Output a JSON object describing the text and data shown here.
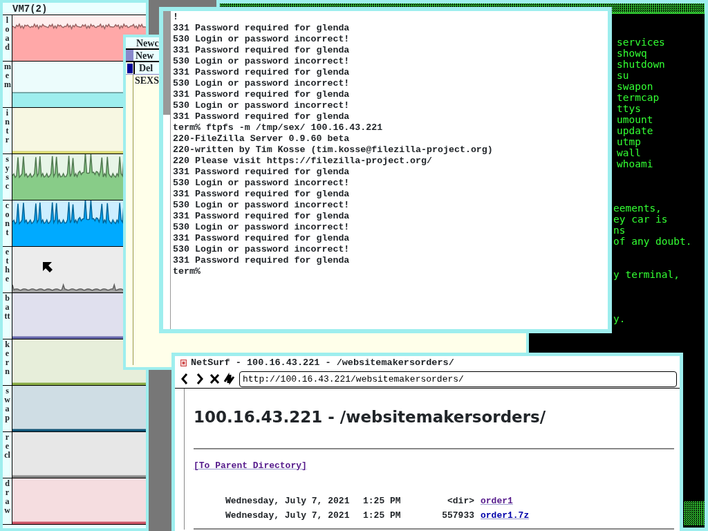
{
  "stats_window": {
    "title": "VM7(2)",
    "graphs": [
      {
        "label": "load",
        "kind": "wave",
        "color": "#ffa8a8"
      },
      {
        "label": "mem",
        "kind": "band",
        "color": "#9eeeee"
      },
      {
        "label": "intr",
        "kind": "flat",
        "color": "#d8d870"
      },
      {
        "label": "sysc",
        "kind": "spiky",
        "color": "#88cc88"
      },
      {
        "label": "cont",
        "kind": "spiky",
        "color": "#00aaff"
      },
      {
        "label": "ethe",
        "kind": "noise",
        "color": "#a0a0a0"
      },
      {
        "label": "batt",
        "kind": "flat",
        "color": "#6666aa"
      },
      {
        "label": "kern",
        "kind": "flat",
        "color": "#88aa44"
      },
      {
        "label": "swap",
        "kind": "flat",
        "color": "#115577"
      },
      {
        "label": "recl",
        "kind": "flat",
        "color": "#888888"
      },
      {
        "label": "draw",
        "kind": "flat",
        "color": "#cc5566"
      }
    ]
  },
  "editor_window": {
    "tag": "Newc",
    "column_tag": "New",
    "window_tag": "Del",
    "body": "SEXS"
  },
  "terminal": {
    "lines": [
      "!",
      "331 Password required for glenda",
      "530 Login or password incorrect!",
      "331 Password required for glenda",
      "530 Login or password incorrect!",
      "331 Password required for glenda",
      "530 Login or password incorrect!",
      "331 Password required for glenda",
      "530 Login or password incorrect!",
      "331 Password required for glenda",
      "term% ftpfs -m /tmp/sex/ 100.16.43.221",
      "220-FileZilla Server 0.9.60 beta",
      "220-written by Tim Kosse (tim.kosse@filezilla-project.org)",
      "220 Please visit https://filezilla-project.org/",
      "331 Password required for glenda",
      "530 Login or password incorrect!",
      "331 Password required for glenda",
      "530 Login or password incorrect!",
      "331 Password required for glenda",
      "530 Login or password incorrect!",
      "331 Password required for glenda",
      "530 Login or password incorrect!",
      "331 Password required for glenda",
      "term%"
    ]
  },
  "green_terminal": {
    "commands": [
      "services",
      "showq",
      "shutdown",
      "su",
      "swapon",
      "termcap",
      "ttys",
      "umount",
      "update",
      "utmp",
      "wall",
      "whoami"
    ],
    "fragments": [
      [
        "eements,",
        "ey car is",
        "ns",
        "of any doubt."
      ],
      [
        "y terminal,"
      ],
      [
        "y."
      ]
    ]
  },
  "browser": {
    "title": "NetSurf - 100.16.43.221 - /websitemakersorders/",
    "url": "http://100.16.43.221/websitemakersorders/",
    "heading": "100.16.43.221 - /websitemakersorders/",
    "parent_link": "[To Parent Directory]",
    "entries": [
      {
        "date": "Wednesday, July 7, 2021",
        "time": "1:25 PM",
        "size": "<dir>",
        "name": "order1",
        "visited": true
      },
      {
        "date": "Wednesday, July 7, 2021",
        "time": "1:25 PM",
        "size": "557933",
        "name": "order1.7z",
        "visited": false
      }
    ]
  }
}
